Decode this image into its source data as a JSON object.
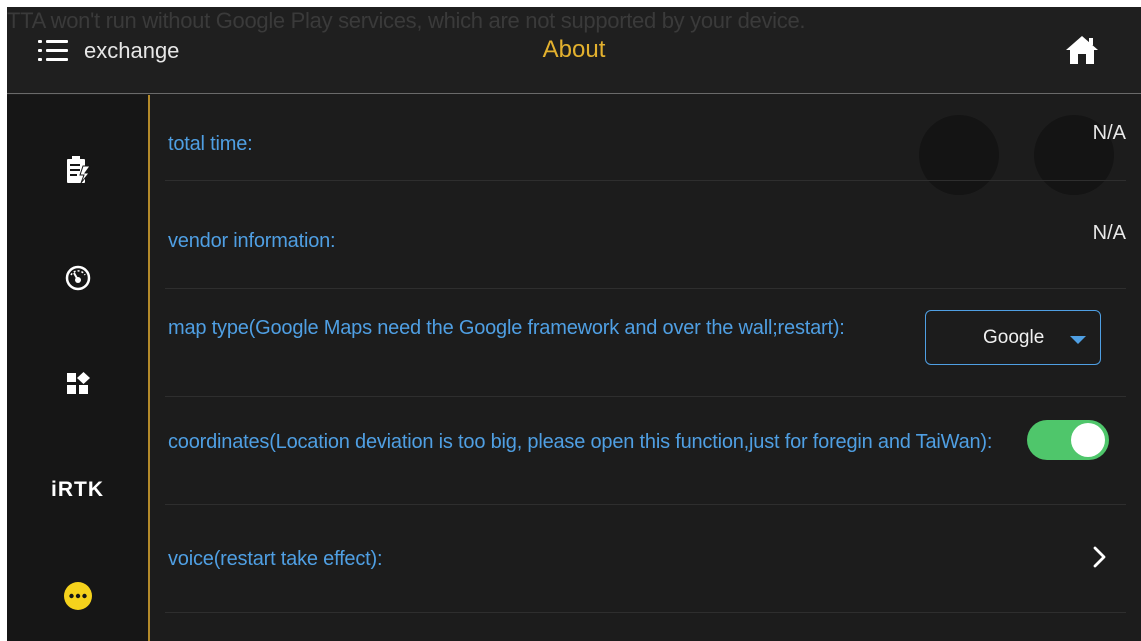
{
  "toast": "TTA won't run without Google Play services, which are not supported by your device.",
  "header": {
    "menu_label": "exchange",
    "title": "About",
    "menu_icon": "hamburger-icon",
    "home_icon": "home-icon"
  },
  "sidebar": {
    "items": [
      {
        "icon": "battery-edit-icon"
      },
      {
        "icon": "speedometer-icon"
      },
      {
        "icon": "apps-grid-icon"
      },
      {
        "label": "iRTK"
      },
      {
        "icon": "more-dots-icon"
      }
    ]
  },
  "settings": {
    "total_time": {
      "label": "total time:",
      "value": "N/A"
    },
    "vendor": {
      "label": "vendor information:",
      "value": "N/A"
    },
    "map_type": {
      "label": "map type(Google Maps need the Google framework and over the wall;restart):",
      "selected": "Google"
    },
    "coordinates": {
      "label": "coordinates(Location deviation is too big, please open this function,just for foregin and TaiWan):",
      "enabled": true
    },
    "voice": {
      "label": "voice(restart take effect):"
    }
  },
  "colors": {
    "accent_blue": "#4f9fe3",
    "title_gold": "#e3b12e",
    "toggle_green": "#4fc66b",
    "more_yellow": "#f5d21c"
  }
}
